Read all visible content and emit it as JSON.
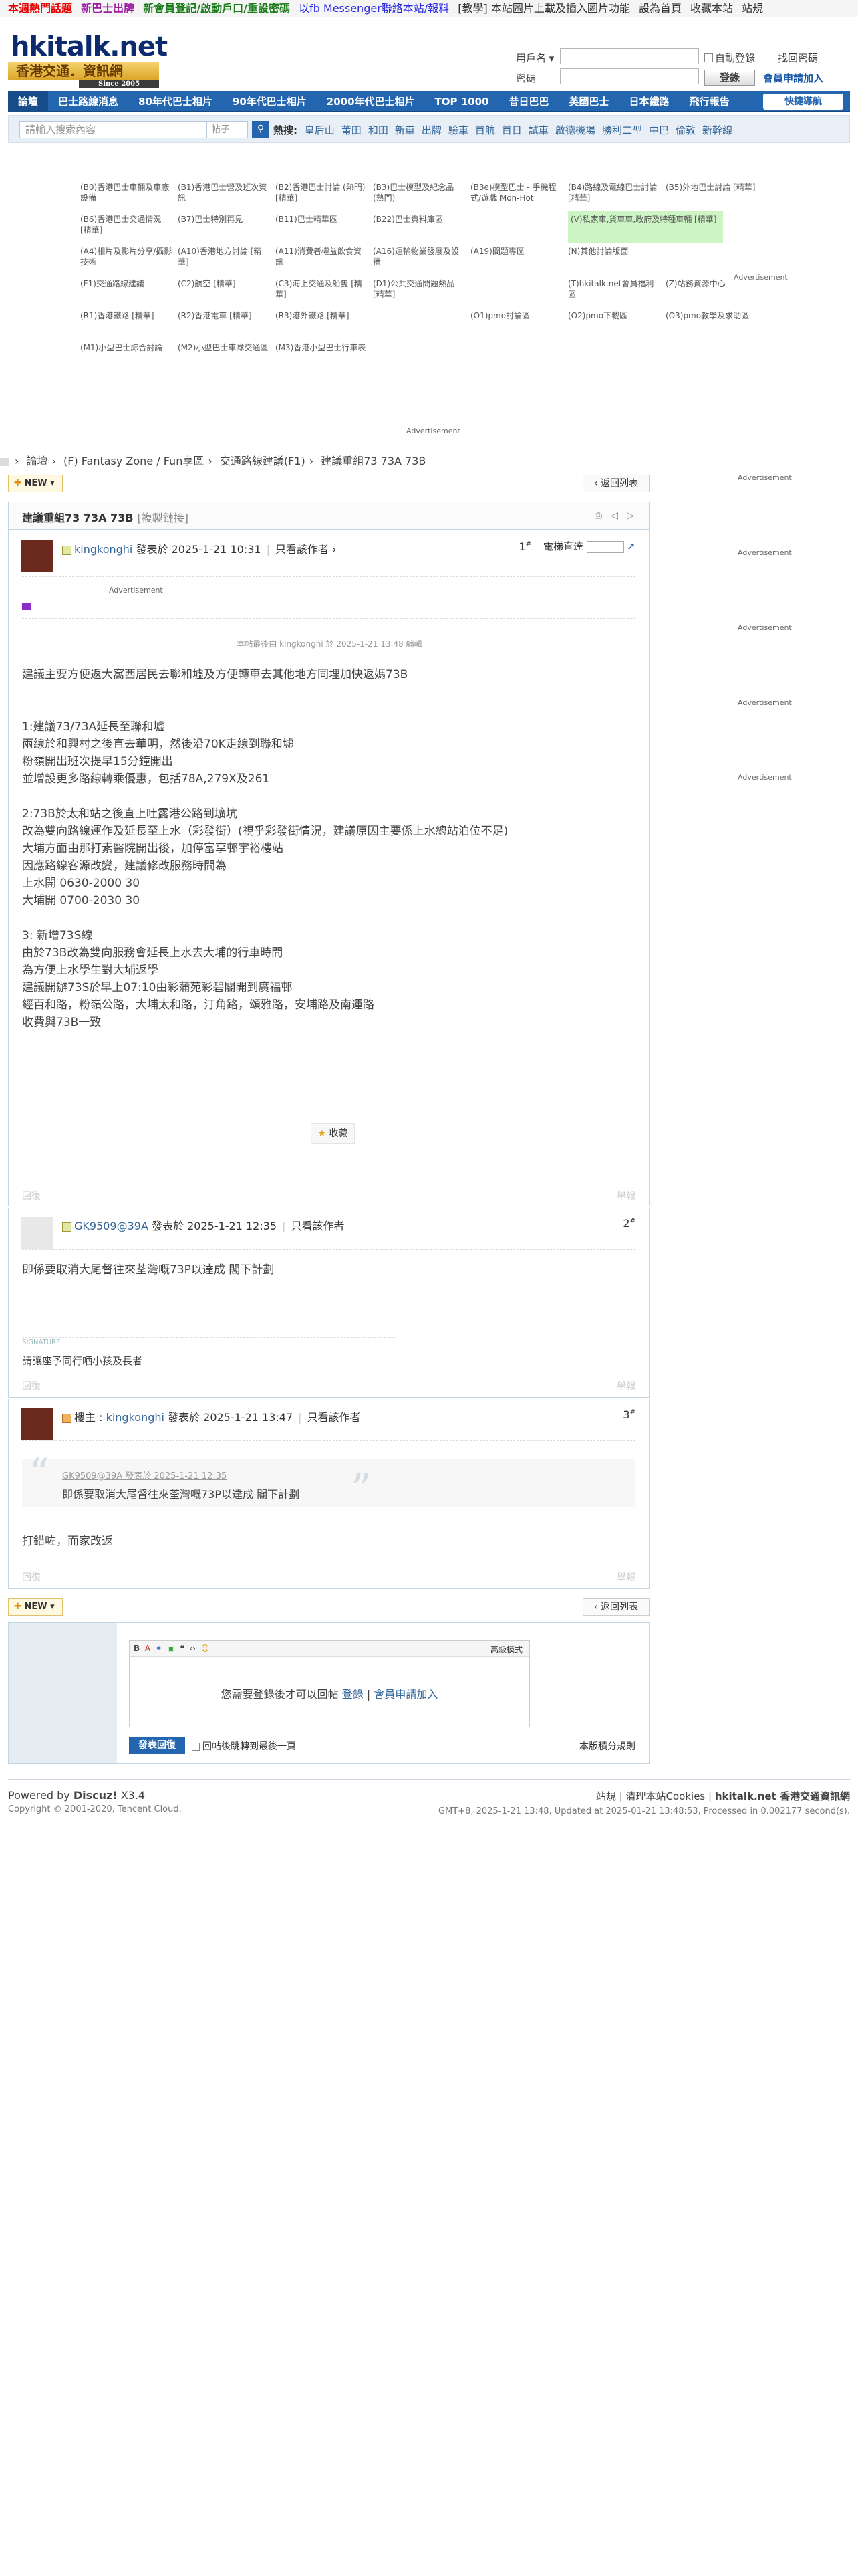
{
  "topbar": {
    "hot": "本週熱門話題",
    "new_bus": "新巴士出牌",
    "member": "新會員登記/啟動戶口/重設密碼",
    "fb": "以fb Messenger聯絡本站/報料",
    "teach": "[教學] 本站圖片上載及插入圖片功能",
    "home": "設為首頁",
    "fav": "收藏本站",
    "site": "站規"
  },
  "logo": {
    "main": "hkitalk.net",
    "sub": "香港交通．資訊網",
    "since": "Since 2005"
  },
  "login": {
    "user_label": "用戶名 ▾",
    "pass_label": "密碼",
    "auto": "自動登錄",
    "find": "找回密碼",
    "login_btn": "登錄",
    "register": "會員申請加入"
  },
  "nav": {
    "items": [
      "論壇",
      "巴士路線消息",
      "80年代巴士相片",
      "90年代巴士相片",
      "2000年代巴士相片",
      "TOP 1000",
      "昔日巴巴",
      "英國巴士",
      "日本鐵路",
      "飛行報告"
    ],
    "quick": "快捷導航"
  },
  "search": {
    "placeholder": "請輸入搜索內容",
    "type": "帖子",
    "hot_label": "熱搜:",
    "hot": [
      "皇后山",
      "莆田",
      "和田",
      "新車",
      "出牌",
      "驗車",
      "首航",
      "首日",
      "試車",
      "啟德機場",
      "勝利二型",
      "中巴",
      "倫敦",
      "新幹線"
    ]
  },
  "advert_label": "Advertisement",
  "forums": [
    "(B0)香港巴士車輛及車廠設備",
    "(B1)香港巴士營及班次資訊",
    "(B2)香港巴士討論 (熱門) [精華]",
    "(B3)巴士模型及紀念品 (熱門)",
    "(B3e)模型巴士 - 手機程式/遊戲 Mon-Hot",
    "(B4)路線及電線巴士討論 [精華]",
    "(B5)外地巴士討論 [精華]",
    "(B6)香港巴士交通情況 [精華]",
    "(B7)巴士特別再見",
    "(B11)巴士精華區",
    "(B22)巴士資料庫區",
    "",
    "(V)私家車,貨車車,政府及特種車輛 [精華]",
    "",
    "(A4)相片及影片分享/攝影技術",
    "(A10)香港地方討論 [精華]",
    "(A11)消費者權益飲食資訊",
    "(A16)運輸物業發展及設備",
    "(A19)間題專區",
    "(N)其他討論版面",
    "",
    "(F1)交通路線建議",
    "(C2)航空 [精華]",
    "(C3)海上交通及船隻 [精華]",
    "(D1)公共交通問題熱品 [精華]",
    "",
    "(T)hkitalk.net會員福利區",
    "(Z)站務資源中心",
    "(R1)香港鐵路 [精華]",
    "(R2)香港電車 [精華]",
    "(R3)港外鐵路 [精華]",
    "",
    "(O1)pmo討論區",
    "(O2)pmo下載區",
    "(O3)pmo教學及求助區",
    "(M1)小型巴士綜合討論",
    "(M2)小型巴士車隊交通區",
    "(M3)香港小型巴士行車表",
    "",
    "",
    "",
    ""
  ],
  "breadcrumb": [
    "論壇",
    "(F) Fantasy Zone / Fun享區",
    "交通路線建議(F1)",
    "建議重組73 73A 73B"
  ],
  "buttons": {
    "new": "NEW",
    "back": "返回列表"
  },
  "thread": {
    "title": "建議重組73 73A 73B",
    "copy": "[複製鏈接]",
    "jump": "電梯直達"
  },
  "posts": [
    {
      "author": "kingkonghi",
      "posted": "發表於 2025-1-21 10:31",
      "only": "只看該作者",
      "floor": "1",
      "edit_note": "本帖最後由 kingkonghi 於 2025-1-21 13:48 編輯",
      "body": "建議主要方便返大窩西居民去聯和墟及方便轉車去其他地方同埋加快返媽73B\n\n\n1:建議73/73A延長至聯和墟\n兩線於和興村之後直去華明，然後沿70K走線到聯和墟\n粉嶺開出班次提早15分鐘開出\n並增設更多路線轉乘優惠，包括78A,279X及261\n\n2:73B於太和站之後直上吐露港公路到壙坑\n改為雙向路線運作及延長至上水（彩發街）(視乎彩發街情況，建議原因主要係上水總站泊位不足)\n大埔方面由那打素醫院開出後，加停富享邨宇裕樓站\n因應路線客源改變，建議修改服務時間為\n上水開 0630-2000 30\n大埔開 0700-2030 30\n\n3: 新增73S線\n由於73B改為雙向服務會延長上水去大埔的行車時間\n為方便上水學生對大埔返學\n建議開辦73S於早上07:10由彩蒲苑彩碧閣開到廣福邨\n經百和路，粉嶺公路，大埔太和路，汀角路，頌雅路，安埔路及南運路\n收費與73B一致",
      "collect": "收藏",
      "reply": "回復",
      "report": "舉報"
    },
    {
      "author": "GK9509@39A",
      "posted": "發表於 2025-1-21 12:35",
      "only": "只看該作者",
      "floor": "2",
      "body": "即係要取消大尾督往來荃灣嘅73P以達成 閣下計劃",
      "signature_label": "SIGNATURE",
      "signature": "請讓座予同行哂小孩及長者",
      "reply": "回復",
      "report": "舉報"
    },
    {
      "role": "樓主",
      "author": "kingkonghi",
      "posted": "發表於 2025-1-21 13:47",
      "only": "只看該作者",
      "floor": "3",
      "quote_meta": "GK9509@39A 發表於 2025-1-21 12:35",
      "quote_body": "即係要取消大尾督往來荃灣嘅73P以達成 閣下計劃",
      "body": "打錯咗，而家改返",
      "reply": "回復",
      "report": "舉報"
    }
  ],
  "fastpost": {
    "advanced": "高級模式",
    "need_login": "您需要登錄後才可以回帖",
    "login": "登錄",
    "register": "會員申請加入",
    "send": "發表回復",
    "option": "回帖後跳轉到最後一頁",
    "rules": "本版積分規則"
  },
  "footer": {
    "powered": "Powered by",
    "brand": "Discuz!",
    "ver": "X3.4",
    "copy": "Copyright © 2001-2020, Tencent Cloud.",
    "links": [
      "站規",
      "清理本站Cookies"
    ],
    "site": "hkitalk.net 香港交通資訊網",
    "time": "GMT+8, 2025-1-21 13:48, Updated at 2025-01-21 13:48:53, Processed in 0.002177 second(s)."
  },
  "colors": {
    "nav": "#2365ae",
    "hot_red": "#e60000",
    "border": "#c2d5e3"
  }
}
